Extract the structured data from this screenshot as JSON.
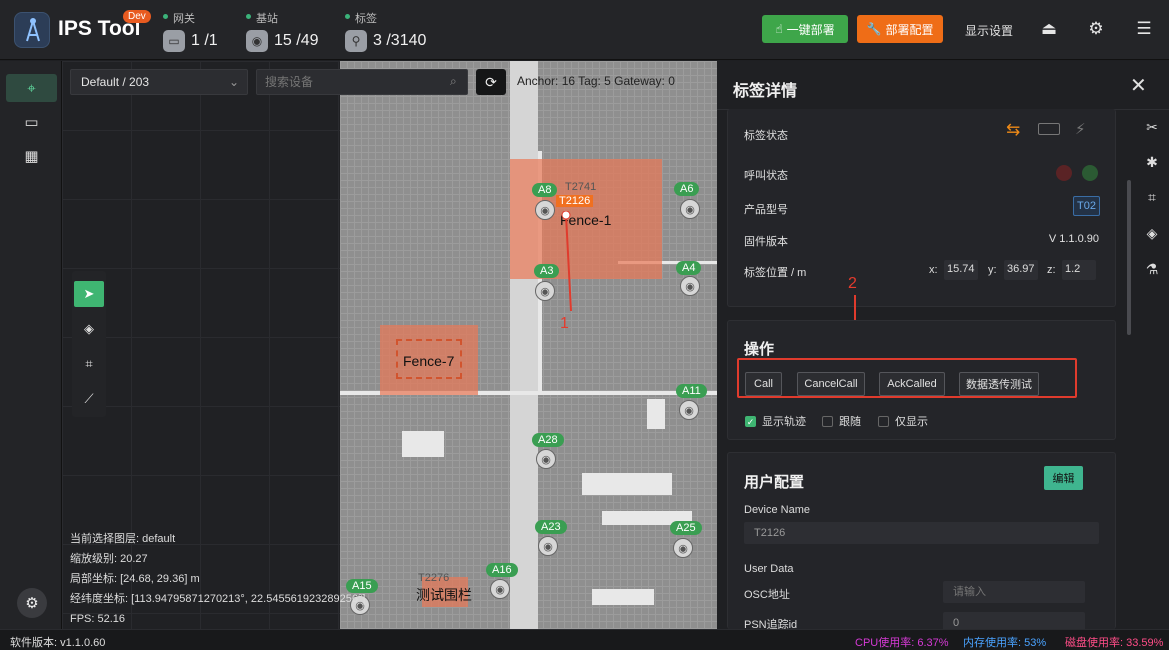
{
  "app": {
    "title": "IPS Tool",
    "badge": "Dev"
  },
  "header": {
    "stats": [
      {
        "label": "网关",
        "value": "1 /1",
        "icon": "gateway-icon"
      },
      {
        "label": "基站",
        "value": "15 /49",
        "icon": "anchor-icon"
      },
      {
        "label": "标签",
        "value": "3 /3140",
        "icon": "tag-icon"
      }
    ],
    "deploy_button": "一键部署",
    "config_button": "部署配置",
    "display_settings": "显示设置"
  },
  "map": {
    "layer_select": "Default / 203",
    "search_placeholder": "搜索设备",
    "counts": "Anchor: 16   Tag: 5   Gateway: 0",
    "fences": [
      "Fence-1",
      "Fence-7",
      "测试围栏"
    ],
    "anchors": [
      "A8",
      "A6",
      "A3",
      "A4",
      "A11",
      "A28",
      "A23",
      "A25",
      "A16",
      "A15"
    ],
    "tags": [
      "T2126",
      "T2741",
      "T2276"
    ],
    "annotations": [
      "1",
      "2"
    ],
    "info": {
      "layer": "当前选择图层:  default",
      "zoom": "缩放级别:  20.27",
      "local": "局部坐标:  [24.68, 29.36] m",
      "lnglat": "经纬度坐标:  [113.94795871270213°, 22.545561923289256°]",
      "fps": "FPS:  52.16"
    }
  },
  "panel": {
    "title": "标签详情",
    "status_label": "标签状态",
    "call_status_label": "呼叫状态",
    "model_label": "产品型号",
    "model_value": "T02",
    "firmware_label": "固件版本",
    "firmware_value": "V 1.1.0.90",
    "position_label": "标签位置 / m",
    "x_label": "x:",
    "x_value": "15.74",
    "y_label": "y:",
    "y_value": "36.97",
    "z_label": "z:",
    "z_value": "1.2",
    "operations_title": "操作",
    "ops": [
      "Call",
      "CancelCall",
      "AckCalled",
      "数据透传测试"
    ],
    "checkboxes": [
      {
        "label": "显示轨迹",
        "checked": true
      },
      {
        "label": "跟随",
        "checked": false
      },
      {
        "label": "仅显示",
        "checked": false
      }
    ],
    "user_config_title": "用户配置",
    "edit_button": "编辑",
    "device_name_label": "Device Name",
    "device_name_value": "T2126",
    "user_data_label": "User Data",
    "osc_label": "OSC地址",
    "osc_placeholder": "请输入",
    "psn_label": "PSN追踪id",
    "psn_value": "0"
  },
  "status": {
    "version": "软件版本: v1.1.0.60",
    "cpu": "CPU使用率: 6.37%",
    "mem": "内存使用率: 53%",
    "disk": "磁盘使用率: 33.59%"
  },
  "colors": {
    "accent_green": "#3fb572",
    "accent_orange": "#ef6d17",
    "highlight_red": "#e03b2d",
    "cpu": "#d63ad6",
    "mem": "#4aa3ff",
    "disk": "#ff4d88"
  }
}
